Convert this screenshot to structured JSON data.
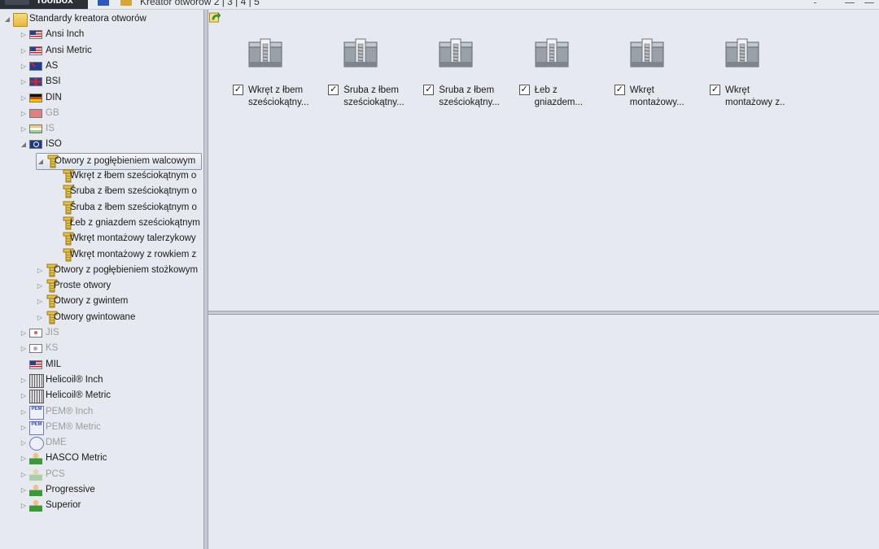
{
  "topbar": {
    "app_title": "Toolbox",
    "breadcrumb": "Kreator otworów 2 | 3 | 4 | 5"
  },
  "tree": {
    "root": {
      "label": "Standardy kreatora otworów",
      "expander": "◢"
    },
    "standards": [
      {
        "label": "Ansi Inch",
        "icon": "us-flag-icon",
        "disabled": false
      },
      {
        "label": "Ansi Metric",
        "icon": "us-flag-icon",
        "disabled": false
      },
      {
        "label": "AS",
        "icon": "au-flag-icon",
        "disabled": false
      },
      {
        "label": "BSI",
        "icon": "uk-flag-icon",
        "disabled": false
      },
      {
        "label": "DIN",
        "icon": "de-flag-icon",
        "disabled": false
      },
      {
        "label": "GB",
        "icon": "cn-flag-icon",
        "disabled": true
      },
      {
        "label": "IS",
        "icon": "in-flag-icon",
        "disabled": true
      },
      {
        "label": "ISO",
        "icon": "iso-flag-icon",
        "disabled": false
      }
    ],
    "iso_children": [
      {
        "label": "Otwory z pogłębieniem walcowym",
        "expanded": true
      },
      {
        "label": "Otwory z pogłębieniem stożkowym",
        "expanded": false
      },
      {
        "label": "Proste otwory",
        "expanded": false
      },
      {
        "label": "Otwory z gwintem",
        "expanded": false
      },
      {
        "label": "Otwory gwintowane",
        "expanded": false
      }
    ],
    "cbore_items": [
      {
        "label": "Wkręt z łbem sześciokątnym o"
      },
      {
        "label": "Śruba z łbem sześciokątnym o"
      },
      {
        "label": "Śruba z łbem sześciokątnym o"
      },
      {
        "label": "Łeb z gniazdem sześciokątnym"
      },
      {
        "label": "Wkręt montażowy talerzykowy"
      },
      {
        "label": "Wkręt montażowy z rowkiem z"
      }
    ],
    "more_standards": [
      {
        "label": "JIS",
        "icon": "jp-flag-icon",
        "disabled": true
      },
      {
        "label": "KS",
        "icon": "kr-flag-icon",
        "disabled": true
      },
      {
        "label": "MIL",
        "icon": "us-flag-icon",
        "disabled": false
      },
      {
        "label": "Helicoil® Inch",
        "icon": "helicoil-icon",
        "disabled": false
      },
      {
        "label": "Helicoil® Metric",
        "icon": "helicoil-icon",
        "disabled": false
      },
      {
        "label": "PEM® Inch",
        "icon": "pem-icon",
        "disabled": true
      },
      {
        "label": "PEM® Metric",
        "icon": "pem-icon",
        "disabled": true
      },
      {
        "label": "DME",
        "icon": "dme-icon",
        "disabled": true
      },
      {
        "label": "HASCO Metric",
        "icon": "person-icon",
        "disabled": false
      },
      {
        "label": "PCS",
        "icon": "person-icon",
        "disabled": true
      },
      {
        "label": "Progressive",
        "icon": "person-icon",
        "disabled": false
      },
      {
        "label": "Superior",
        "icon": "person-icon",
        "disabled": false
      }
    ],
    "pem_glyph": "PEM"
  },
  "tiles": [
    {
      "line1": "Wkręt z łbem",
      "line2": "sześciokątny...",
      "checked": true
    },
    {
      "line1": "Śruba z łbem",
      "line2": "sześciokątny...",
      "checked": true
    },
    {
      "line1": "Śruba z łbem",
      "line2": "sześciokątny...",
      "checked": true
    },
    {
      "line1": "Łeb z",
      "line2": "gniazdem...",
      "checked": true
    },
    {
      "line1": "Wkręt",
      "line2": "montażowy...",
      "checked": true
    },
    {
      "line1": "Wkręt",
      "line2": "montażowy z..",
      "checked": true
    }
  ],
  "check_glyph": "✓",
  "colors": {
    "accent": "#c9a227",
    "selection_border": "#8a95a5"
  }
}
